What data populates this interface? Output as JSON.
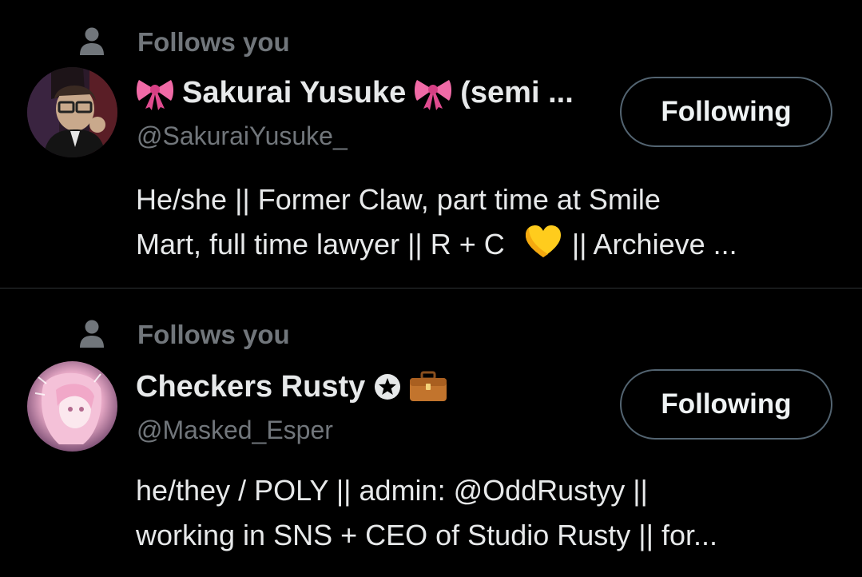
{
  "theme": {
    "background": "#000000",
    "primary_text": "#e7e9ea",
    "secondary_text": "#71767b",
    "divider": "#2f3336",
    "button_border": "#536471"
  },
  "users": [
    {
      "follows_label": "Follows you",
      "display_name_main": "Sakurai Yusuke",
      "display_name_tail": "(semi ...",
      "name_emoji": "ribbon-bow-icon",
      "handle": "@SakuraiYusuke_",
      "button_label": "Following",
      "bio_line1": "He/she || Former Claw, part time at Smile",
      "bio_line2_a": "Mart, full time lawyer || R + C",
      "bio_line2_b": "|| Archieve ...",
      "bio_emoji": "yellow-heart-icon"
    },
    {
      "follows_label": "Follows you",
      "display_name_main": "Checkers Rusty",
      "name_emoji": "briefcase-icon",
      "badge": "star-badge-icon",
      "handle": "@Masked_Esper",
      "button_label": "Following",
      "bio_line1": "he/they / POLY || admin: @OddRustyy ||",
      "bio_line2": "working in SNS + CEO of Studio Rusty || for..."
    }
  ]
}
